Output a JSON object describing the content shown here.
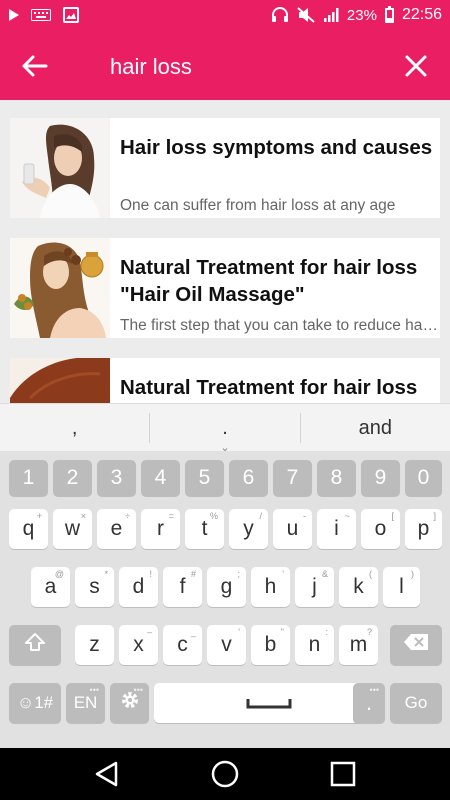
{
  "status_bar": {
    "battery_percent": "23%",
    "time": "22:56"
  },
  "search": {
    "query": "hair loss"
  },
  "results": [
    {
      "title": "Hair loss symptoms and causes",
      "subtitle": "One can suffer from hair loss at any age"
    },
    {
      "title": "Natural Treatment  for hair loss \"Hair Oil Massage\"",
      "subtitle": "The first step that you can take to reduce hair loss"
    },
    {
      "title": "Natural Treatment for hair loss",
      "subtitle": ""
    }
  ],
  "suggestions": [
    ",",
    ".",
    "and"
  ],
  "keyboard": {
    "number_row": [
      "1",
      "2",
      "3",
      "4",
      "5",
      "6",
      "7",
      "8",
      "9",
      "0"
    ],
    "row1": [
      "q",
      "w",
      "e",
      "r",
      "t",
      "y",
      "u",
      "i",
      "o",
      "p"
    ],
    "row1_hints": [
      "+",
      "×",
      "÷",
      "=",
      "%",
      "/",
      "-",
      "~",
      "[",
      "]"
    ],
    "row2": [
      "a",
      "s",
      "d",
      "f",
      "g",
      "h",
      "j",
      "k",
      "l"
    ],
    "row2_hints": [
      "@",
      "*",
      "!",
      "#",
      ";",
      "'",
      "&",
      "(",
      ")"
    ],
    "row3": [
      "z",
      "x",
      "c",
      "v",
      "b",
      "n",
      "m"
    ],
    "row3_hints": [
      "",
      "–",
      "_",
      "'",
      "\"",
      ":",
      "?"
    ],
    "emoji_label": "☺1#",
    "language_label": "EN",
    "period_label": ".",
    "go_label": "Go"
  }
}
